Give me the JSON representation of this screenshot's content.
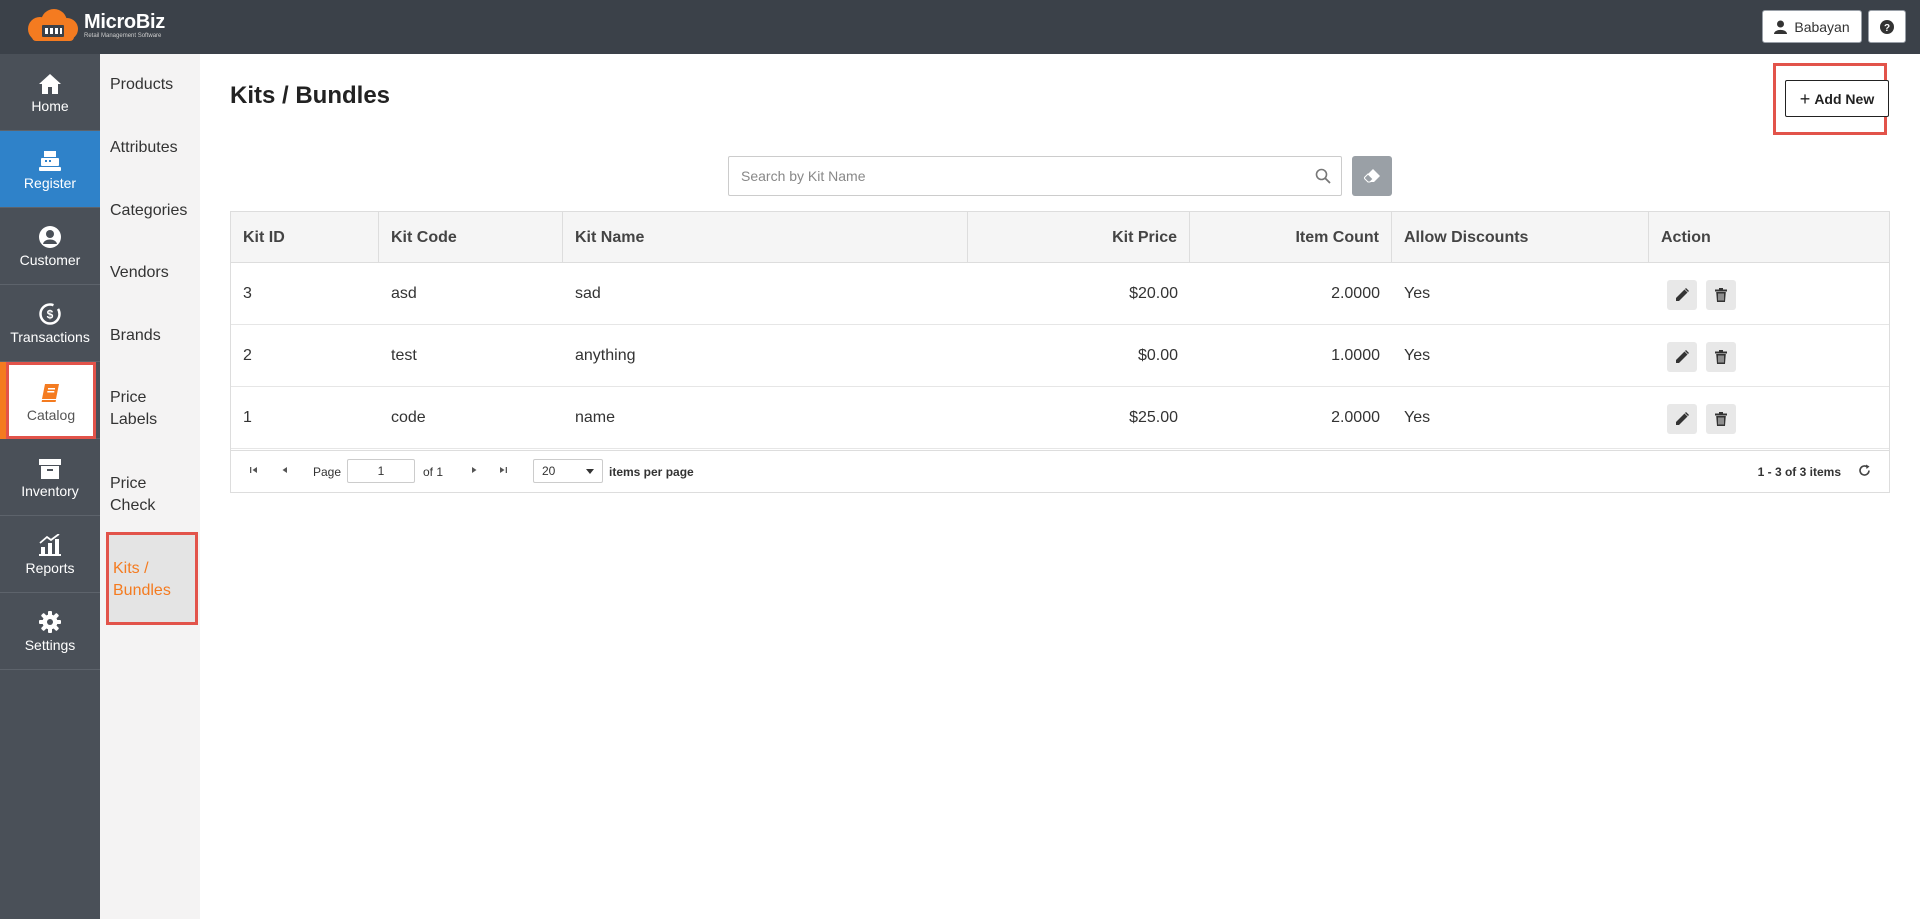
{
  "brand": {
    "name": "MicroBiz",
    "tagline": "Retail Management Software",
    "accent": "#f47b20"
  },
  "header": {
    "user_name": "Babayan",
    "help_label": "?"
  },
  "nav": [
    {
      "label": "Home",
      "icon": "home-icon"
    },
    {
      "label": "Register",
      "icon": "register-icon"
    },
    {
      "label": "Customer",
      "icon": "customer-icon"
    },
    {
      "label": "Transactions",
      "icon": "transactions-icon"
    },
    {
      "label": "Catalog",
      "icon": "catalog-icon"
    },
    {
      "label": "Inventory",
      "icon": "inventory-icon"
    },
    {
      "label": "Reports",
      "icon": "reports-icon"
    },
    {
      "label": "Settings",
      "icon": "settings-icon"
    }
  ],
  "subnav": [
    {
      "label": "Products"
    },
    {
      "label": "Attributes"
    },
    {
      "label": "Categories"
    },
    {
      "label": "Vendors"
    },
    {
      "label": "Brands"
    },
    {
      "label": "Price Labels"
    },
    {
      "label": "Price Check"
    },
    {
      "label": "Kits / Bundles"
    }
  ],
  "page": {
    "title": "Kits / Bundles",
    "add_new_label": "Add New",
    "search_placeholder": "Search by Kit Name",
    "search_value": ""
  },
  "table": {
    "columns": [
      "Kit ID",
      "Kit Code",
      "Kit Name",
      "Kit Price",
      "Item Count",
      "Allow Discounts",
      "Action"
    ],
    "rows": [
      {
        "id": "3",
        "code": "asd",
        "name": "sad",
        "price": "$20.00",
        "count": "2.0000",
        "discounts": "Yes"
      },
      {
        "id": "2",
        "code": "test",
        "name": "anything",
        "price": "$0.00",
        "count": "1.0000",
        "discounts": "Yes"
      },
      {
        "id": "1",
        "code": "code",
        "name": "name",
        "price": "$25.00",
        "count": "2.0000",
        "discounts": "Yes"
      }
    ]
  },
  "pager": {
    "page_label": "Page",
    "page_value": "1",
    "of_label": "of 1",
    "per_page_value": "20",
    "per_page_label": "items per page",
    "summary": "1 - 3 of 3 items"
  }
}
